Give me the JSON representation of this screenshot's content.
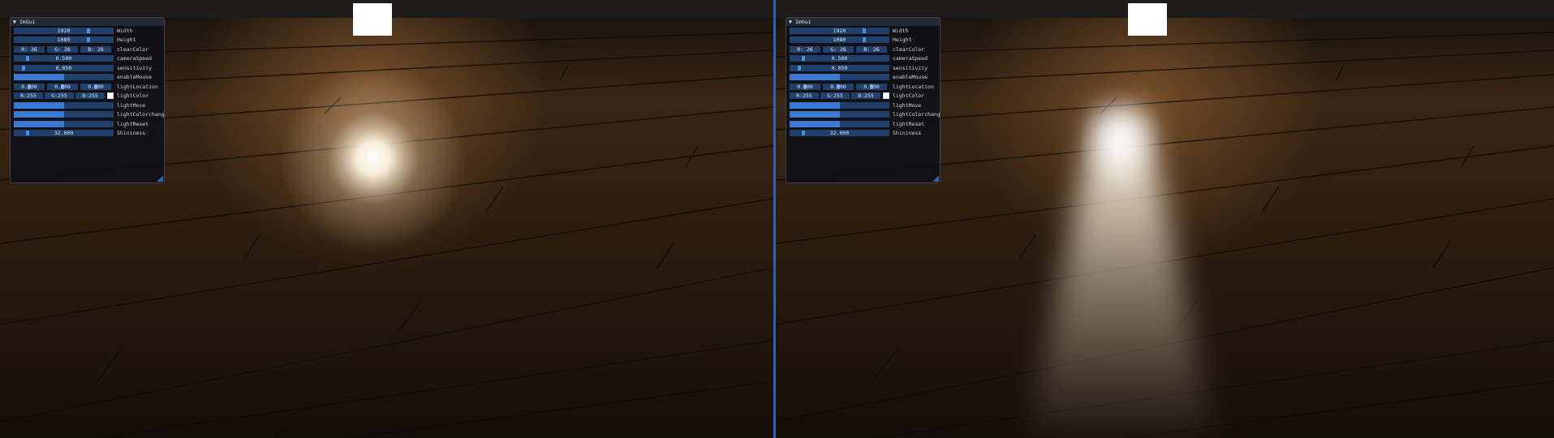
{
  "window_title": "ImGui",
  "panels": [
    {
      "title": "ImGui",
      "width": "1920",
      "height": "1080",
      "clearColor": [
        "R: 26",
        "G: 26",
        "B: 26"
      ],
      "cameraSpeed": "0.500",
      "sensitivity": "0.050",
      "lightLocation": [
        "0.000",
        "0.000",
        "0.000"
      ],
      "lightColor": [
        "R:255",
        "G:255",
        "B:255"
      ],
      "shininess": "32.000",
      "labels": {
        "width": "Width",
        "height": "Height",
        "clearColor": "clearColor",
        "cameraSpeed": "cameraSpeed",
        "sensitivity": "sensitivity",
        "enableMouse": "enableMouse",
        "lightLocation": "lightLocation",
        "lightColor": "lightColor",
        "lightMove": "lightMove",
        "lightColorchange": "lightColorchange",
        "lightReset": "lightReset",
        "shininess": "Shininess"
      }
    },
    {
      "title": "ImGui",
      "width": "1920",
      "height": "1080",
      "clearColor": [
        "R: 26",
        "G: 26",
        "B: 26"
      ],
      "cameraSpeed": "0.500",
      "sensitivity": "0.050",
      "lightLocation": [
        "0.000",
        "0.000",
        "0.000"
      ],
      "lightColor": [
        "R:255",
        "G:255",
        "B:255"
      ],
      "shininess": "32.000",
      "labels": {
        "width": "Width",
        "height": "Height",
        "clearColor": "clearColor",
        "cameraSpeed": "cameraSpeed",
        "sensitivity": "sensitivity",
        "enableMouse": "enableMouse",
        "lightLocation": "lightLocation",
        "lightColor": "lightColor",
        "lightMove": "lightMove",
        "lightColorchange": "lightColorchange",
        "lightReset": "lightReset",
        "shininess": "Shininess"
      }
    }
  ],
  "colors": {
    "accent": "#3a7ad2",
    "frame_bg": "#20406b",
    "divider": "#2a62b8",
    "floor_wood": "#3a2614",
    "light_color": "#ffffff"
  }
}
